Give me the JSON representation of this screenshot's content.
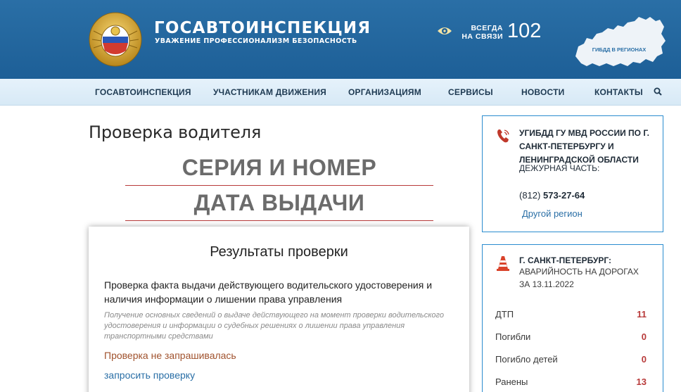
{
  "header": {
    "brand_title": "ГОСАВТОИНСПЕКЦИЯ",
    "brand_subtitle": "УВАЖЕНИЕ ПРОФЕССИОНАЛИЗМ БЕЗОПАСНОСТЬ",
    "always_line1": "ВСЕГДА",
    "always_line2": "НА СВЯЗИ",
    "hotline": "102",
    "map_label": "ГИБДД В РЕГИОНАХ"
  },
  "nav": {
    "items": [
      {
        "label": "ГОСАВТОИНСПЕКЦИЯ"
      },
      {
        "label": "УЧАСТНИКАМ ДВИЖЕНИЯ"
      },
      {
        "label": "ОРГАНИЗАЦИЯМ"
      },
      {
        "label": "СЕРВИСЫ"
      },
      {
        "label": "НОВОСТИ"
      },
      {
        "label": "КОНТАКТЫ"
      }
    ]
  },
  "main": {
    "page_title": "Проверка водителя",
    "heading_series": "СЕРИЯ И НОМЕР",
    "heading_date": "ДАТА ВЫДАЧИ",
    "results": {
      "title": "Результаты проверки",
      "description": "Проверка факта выдачи действующего водительского удостоверения и наличия информации о лишении права управления",
      "note": "Получение основных сведений о выдаче действующего на момент проверки водительского удостоверения и информации о судебных решениях о лишении права управления транспортными средствами",
      "status": "Проверка не запрашивалась",
      "request_link": "запросить проверку"
    }
  },
  "contacts": {
    "org": "УГИБДД ГУ МВД РОССИИ ПО Г. САНКТ-ПЕТЕРБУРГУ И ЛЕНИНГРАДСКОЙ ОБЛАСТИ",
    "duty": "ДЕЖУРНАЯ ЧАСТЬ:",
    "phone_code": "(812)",
    "phone_number": "573-27-64",
    "other_region": "Другой регион"
  },
  "accidents": {
    "city": "Г. САНКТ-ПЕТЕРБУРГ:",
    "subtitle": "АВАРИЙНОСТЬ НА ДОРОГАХ",
    "date": "ЗА 13.11.2022",
    "stats": [
      {
        "label": "ДТП",
        "value": "11"
      },
      {
        "label": "Погибли",
        "value": "0"
      },
      {
        "label": "Погибло детей",
        "value": "0"
      },
      {
        "label": "Ранены",
        "value": "13"
      }
    ]
  },
  "colors": {
    "header_blue": "#1d5f97",
    "nav_bg": "#d7e9f6",
    "accent_red": "#b83a3a",
    "link_blue": "#2a6fa6"
  }
}
